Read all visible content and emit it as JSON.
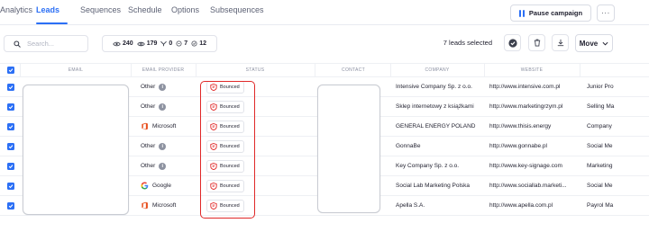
{
  "tabs": [
    {
      "label": "Analytics",
      "active": false
    },
    {
      "label": "Leads",
      "active": true
    },
    {
      "label": "Sequences",
      "active": false
    },
    {
      "label": "Schedule",
      "active": false
    },
    {
      "label": "Options",
      "active": false
    },
    {
      "label": "Subsequences",
      "active": false
    }
  ],
  "header_actions": {
    "pause_label": "Pause campaign",
    "more_label": "···"
  },
  "toolbar": {
    "search_placeholder": "Search...",
    "stats": [
      {
        "icon": "eye-icon",
        "value": "240"
      },
      {
        "icon": "eye-icon",
        "value": "179"
      },
      {
        "icon": "reply-icon",
        "value": "0"
      },
      {
        "icon": "link-icon",
        "value": "7"
      },
      {
        "icon": "check-circle-icon",
        "value": "12"
      }
    ],
    "selected_text": "7 leads selected",
    "move_label": "Move"
  },
  "table": {
    "headers": [
      "EMAIL",
      "EMAIL PROVIDER",
      "STATUS",
      "CONTACT",
      "COMPANY",
      "WEBSITE"
    ],
    "rows": [
      {
        "provider": "Other",
        "provider_icon": "info-icon",
        "status": "Bounced",
        "company": "Intensive Company Sp. z o.o.",
        "website": "http://www.intensive.com.pl",
        "extra": "Junior Pro"
      },
      {
        "provider": "Other",
        "provider_icon": "info-icon",
        "status": "Bounced",
        "company": "Sklep internetowy z książkami",
        "website": "http://www.marketingrzym.pl",
        "extra": "Selling Ma"
      },
      {
        "provider": "Microsoft",
        "provider_icon": "microsoft-office-icon",
        "status": "Bounced",
        "company": "GENERAL ENERGY POLAND",
        "website": "http://www.thisis.energy",
        "extra": "Company"
      },
      {
        "provider": "Other",
        "provider_icon": "info-icon",
        "status": "Bounced",
        "company": "GonnaBe",
        "website": "http://www.gonnabe.pl",
        "extra": "Social Me"
      },
      {
        "provider": "Other",
        "provider_icon": "info-icon",
        "status": "Bounced",
        "company": "Key Company Sp. z o.o.",
        "website": "http://www.key-signage.com",
        "extra": "Marketing"
      },
      {
        "provider": "Google",
        "provider_icon": "google-icon",
        "status": "Bounced",
        "company": "Social Lab Marketing Polska",
        "website": "http://www.sociallab.marketi...",
        "extra": "Social Me"
      },
      {
        "provider": "Microsoft",
        "provider_icon": "microsoft-office-icon",
        "status": "Bounced",
        "company": "Apella S.A.",
        "website": "http://www.apella.com.pl",
        "extra": "Payrol Ma"
      }
    ]
  },
  "colors": {
    "accent": "#2b6ff5",
    "bounced": "#e02828",
    "highlight": "#e02828"
  }
}
